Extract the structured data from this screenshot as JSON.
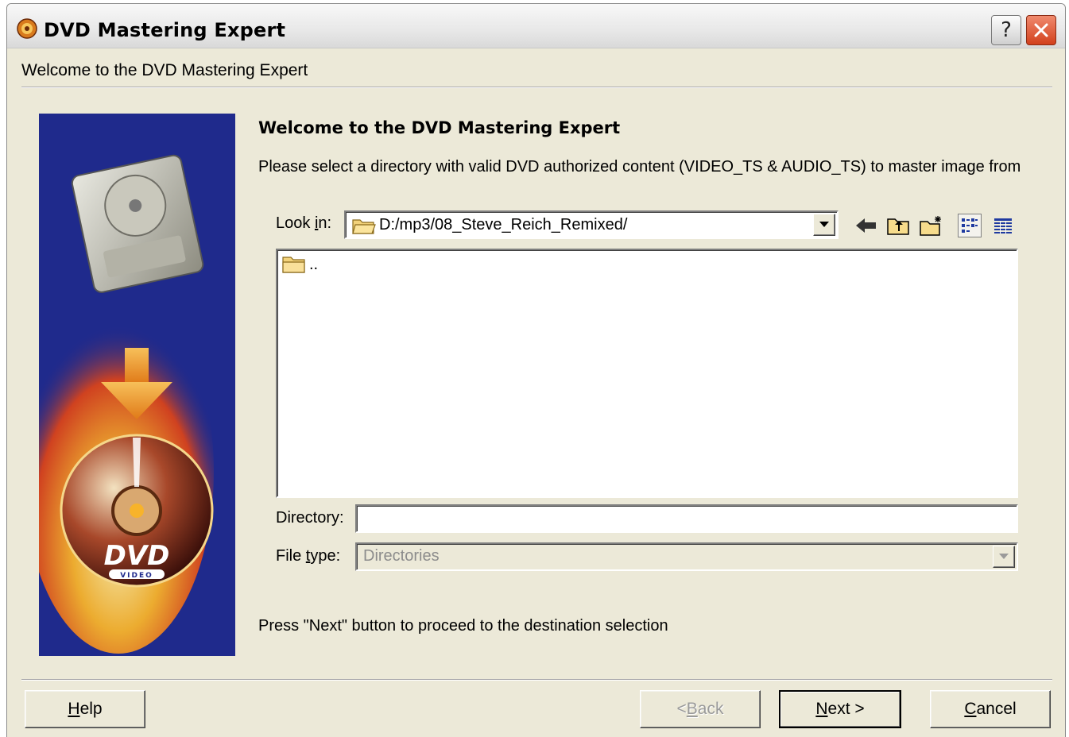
{
  "window": {
    "title": "DVD Mastering Expert",
    "header": "Welcome to the DVD Mastering Expert",
    "help_glyph": "?"
  },
  "page": {
    "title": "Welcome to the DVD Mastering Expert",
    "description": "Please select a directory with valid DVD authorized content (VIDEO_TS & AUDIO_TS) to master image from",
    "hint": "Press \"Next\" button to proceed to the destination selection"
  },
  "dialog": {
    "lookin": {
      "label_pre": "Look ",
      "label_ul": "i",
      "label_post": "n:",
      "value": "D:/mp3/08_Steve_Reich_Remixed/"
    },
    "toolbar_icons": [
      "back-arrow-icon",
      "parent-folder-icon",
      "new-folder-icon",
      "list-view-icon",
      "detail-view-icon"
    ],
    "files": [
      {
        "name": "..",
        "icon": "folder-icon"
      }
    ],
    "directory": {
      "label": "Directory:",
      "value": ""
    },
    "filetype": {
      "label_pre": "File ",
      "label_ul": "t",
      "label_post": "ype:",
      "value": "Directories"
    }
  },
  "buttons": {
    "help": {
      "ul": "H",
      "rest": "elp"
    },
    "back": {
      "pre": "< ",
      "ul": "B",
      "rest": "ack"
    },
    "next": {
      "ul": "N",
      "rest": "ext >"
    },
    "cancel": {
      "ul": "C",
      "rest": "ancel"
    }
  },
  "banner": {
    "logo_text": "DVD",
    "logo_subtext": "VIDEO",
    "colors": {
      "background": "#1f2a8c",
      "flame": "#f5a623",
      "arrow": "#f0a030"
    }
  }
}
